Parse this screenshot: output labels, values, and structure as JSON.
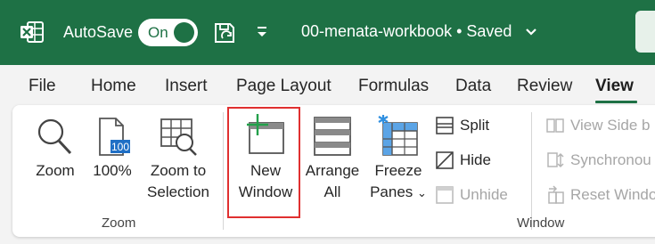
{
  "titlebar": {
    "autosave_label": "AutoSave",
    "autosave_state": "On",
    "document_title": "00-menata-workbook • Saved",
    "bg_color": "#1e7145",
    "icons": [
      "excel-logo-icon",
      "save-sync-icon",
      "customize-qat-icon",
      "chevron-down-icon"
    ]
  },
  "tabs": [
    {
      "label": "File"
    },
    {
      "label": "Home"
    },
    {
      "label": "Insert"
    },
    {
      "label": "Page Layout"
    },
    {
      "label": "Formulas"
    },
    {
      "label": "Data"
    },
    {
      "label": "Review"
    },
    {
      "label": "View",
      "active": true
    }
  ],
  "ribbon": {
    "zoom_group": {
      "label": "Zoom",
      "zoom": "Zoom",
      "zoom100": "100%",
      "zoom100_icon_text": "100",
      "zoom_sel_line1": "Zoom to",
      "zoom_sel_line2": "Selection"
    },
    "window_group": {
      "label": "Window",
      "new_window_line1": "New",
      "new_window_line2": "Window",
      "arrange_line1": "Arrange",
      "arrange_line2": "All",
      "freeze_line1": "Freeze",
      "freeze_line2": "Panes",
      "split": "Split",
      "hide": "Hide",
      "unhide": "Unhide",
      "view_side": "View Side b",
      "synchronous": "Synchronou",
      "reset_window": "Reset Windo"
    },
    "highlight_color": "#e03030"
  }
}
